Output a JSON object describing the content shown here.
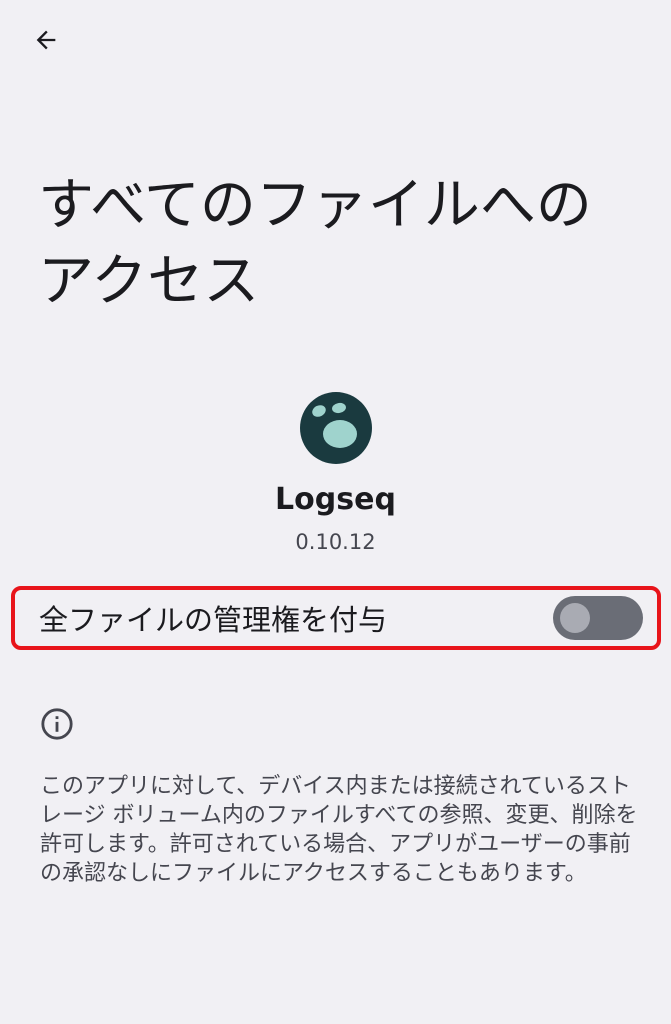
{
  "header": {
    "back_icon": "arrow-left-icon"
  },
  "page": {
    "title_line1": "すべてのファイルへの",
    "title_line2": "アクセス"
  },
  "app": {
    "icon": "logseq-app-icon",
    "name": "Logseq",
    "version": "0.10.12"
  },
  "permission": {
    "toggle_label": "全ファイルの管理権を付与",
    "toggle_state": "off"
  },
  "info": {
    "icon": "info-icon",
    "description": "このアプリに対して、デバイス内または接続されているストレージ ボリューム内のファイルすべての参照、変更、削除を許可します。許可されている場合、アプリがユーザーの事前の承認なしにファイルにアクセスすることもあります。"
  },
  "colors": {
    "background": "#f1f0f4",
    "highlight": "#e8141a",
    "switch_track": "#6a6d76",
    "switch_thumb": "#a9abb3",
    "icon_bg": "#1a3a3f",
    "icon_spots": "#9fd3cd"
  }
}
